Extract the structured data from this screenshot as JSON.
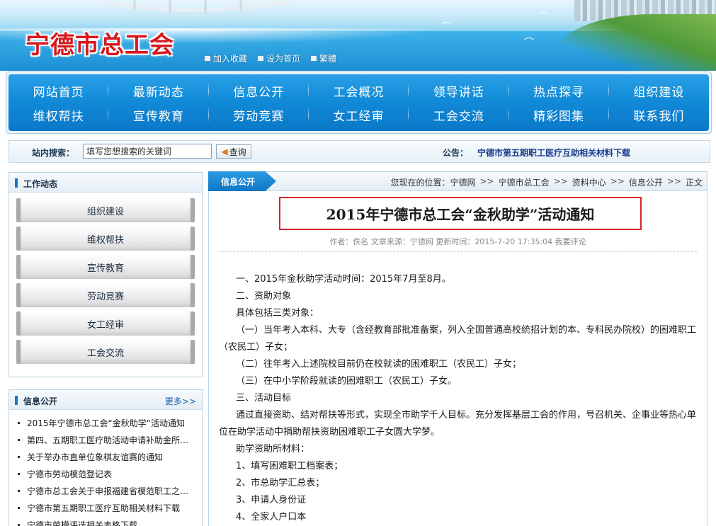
{
  "site": {
    "title": "宁德市总工会",
    "top_links": [
      {
        "icon": "bookmark-icon",
        "label": "加入收藏"
      },
      {
        "icon": "home-icon",
        "label": "设为首页"
      },
      {
        "icon": "text-icon",
        "label": "繁體"
      }
    ]
  },
  "nav": {
    "row1": [
      "网站首页",
      "最新动态",
      "信息公开",
      "工会概况",
      "领导讲话",
      "热点探寻",
      "组织建设"
    ],
    "row2": [
      "维权帮扶",
      "宣传教育",
      "劳动竞赛",
      "女工经审",
      "工会交流",
      "精彩图集",
      "联系我们"
    ]
  },
  "search": {
    "label": "站内搜索：",
    "value": "填写您想搜索的关键词",
    "button": "查询"
  },
  "notice": {
    "label": "公告：",
    "text": "宁德市第五期职工医疗互助相关材料下载"
  },
  "work": {
    "title": "工作动态",
    "items": [
      "组织建设",
      "维权帮扶",
      "宣传教育",
      "劳动竞赛",
      "女工经审",
      "工会交流"
    ]
  },
  "info": {
    "title": "信息公开",
    "more": "更多>>",
    "items": [
      "2015年宁德市总工会“金秋助学”活动通知",
      "第四、五期职工医疗助活动申请补助金所…",
      "关于举办市直单位象棋友谊赛的通知",
      "宁德市劳动模范登记表",
      "宁德市总工会关于申报福建省模范职工之家…",
      "宁德市第五期职工医疗互助相关材料下载",
      "宁德市劳模评选相关表格下载"
    ]
  },
  "article": {
    "tab": "信息公开",
    "breadcrumb": {
      "prefix": "您现在的位置：",
      "items": [
        "宁德网",
        "宁德市总工会",
        "资料中心",
        "信息公开",
        "正文"
      ],
      "sep": ">>"
    },
    "title": "2015年宁德市总工会“金秋助学”活动通知",
    "meta": "作者：佚名  文章来源：宁德网  更新时间：2015-7-20 17:35:04  我要评论",
    "paragraphs": [
      {
        "style": "ind",
        "text": "一、2015年金秋助学活动时间：2015年7月至8月。"
      },
      {
        "style": "ind",
        "text": "二、资助对象"
      },
      {
        "style": "ind",
        "text": "具体包括三类对象："
      },
      {
        "style": "ind",
        "text": "（一）当年考入本科、大专（含经教育部批准备案，列入全国普通高校统招计划的本、专科民办院校）的困难职工（农民工）子女；"
      },
      {
        "style": "ind",
        "text": "（二）往年考入上述院校目前仍在校就读的困难职工（农民工）子女；"
      },
      {
        "style": "ind",
        "text": "（三）在中小学阶段就读的困难职工（农民工）子女。"
      },
      {
        "style": "ind",
        "text": "三、活动目标"
      },
      {
        "style": "ind",
        "text": "通过直接资助、结对帮扶等形式，实现全市助学千人目标。充分发挥基层工会的作用，号召机关、企事业等热心单位在助学活动中捐助帮扶资助困难职工子女圆大学梦。"
      },
      {
        "style": "ind",
        "text": "助学资助所材料："
      },
      {
        "style": "ind",
        "text": "1、填写困难职工档案表；"
      },
      {
        "style": "ind",
        "text": "2、市总助学汇总表；"
      },
      {
        "style": "ind",
        "text": "3、申请人身份证"
      },
      {
        "style": "ind",
        "text": "4、全家人户口本"
      }
    ]
  }
}
